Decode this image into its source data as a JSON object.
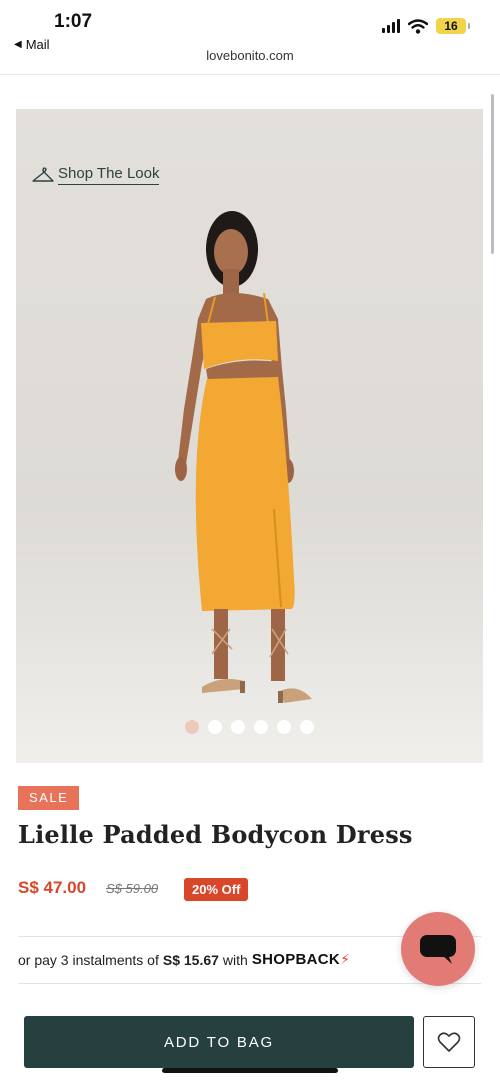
{
  "status_bar": {
    "time": "1:07",
    "back_app": "Mail",
    "battery": "16"
  },
  "browser": {
    "url": "lovebonito.com"
  },
  "gallery": {
    "shop_the_look": "Shop The Look",
    "slide_count": 6,
    "active_slide": 1
  },
  "product": {
    "badge": "SALE",
    "title": "Lielle Padded Bodycon Dress",
    "price": "S$ 47.00",
    "original_price": "S$ 59.00",
    "discount": "20% Off",
    "dress_color": "#f2a833"
  },
  "instalment": {
    "prefix": "or pay 3 instalments of",
    "amount": "S$ 15.67",
    "suffix": "with",
    "provider": "SHOPBACK"
  },
  "actions": {
    "add_to_bag": "ADD TO BAG"
  },
  "colors": {
    "accent": "#26403f",
    "sale": "#d9472b",
    "badge": "#e8735a",
    "chat": "#e27a76"
  }
}
